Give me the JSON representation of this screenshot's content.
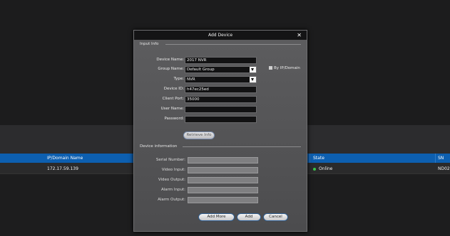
{
  "table": {
    "columns": [
      "IP/Domain Name",
      "State",
      "SN"
    ],
    "rows": [
      {
        "ip": "172.17.59.139",
        "state": "Online",
        "sn": "ND02"
      }
    ]
  },
  "dialog": {
    "title": "Add Device",
    "close_glyph": "✕",
    "input_info_label": "Input Info",
    "fields": {
      "device_name": {
        "label": "Device Name:",
        "value": "2017 NVR"
      },
      "group_name": {
        "label": "Group Name:",
        "value": "Default Group"
      },
      "type": {
        "label": "Type:",
        "value": "NVR"
      },
      "device_id": {
        "label": "Device ID:",
        "value": "h47ec25ed"
      },
      "client_port": {
        "label": "Client Port:",
        "value": "35000"
      },
      "user_name": {
        "label": "User Name:",
        "value": ""
      },
      "password": {
        "label": "Password:",
        "value": ""
      }
    },
    "by_ip_label": "By IP/Domain",
    "retrieve_button": "Retrieve Info",
    "device_information_label": "Device information",
    "info_fields": {
      "serial_number": "Serial Number:",
      "video_input": "Video Input:",
      "video_output": "Video Output:",
      "alarm_input": "Alarm Input:",
      "alarm_output": "Alarm Output:"
    },
    "buttons": {
      "add_more": "Add More",
      "add": "Add",
      "cancel": "Cancel"
    }
  },
  "colors": {
    "table_header": "#0d5fb0",
    "online_dot": "#39c24a",
    "dialog_title_bar": "#141415"
  }
}
